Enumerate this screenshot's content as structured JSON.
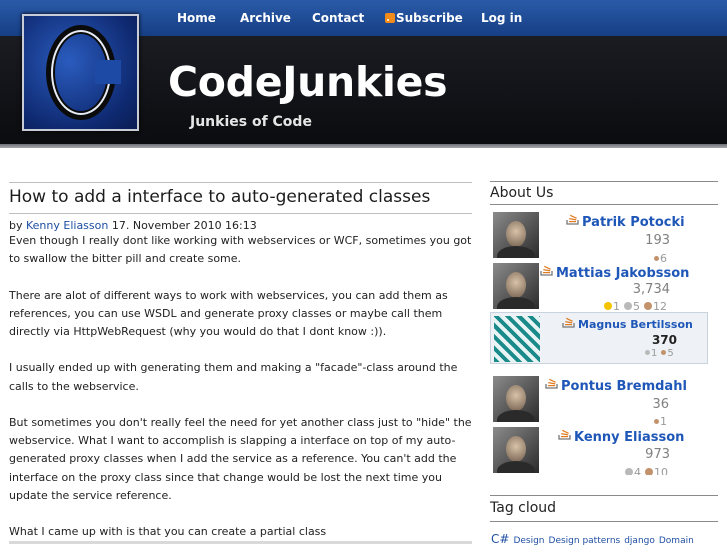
{
  "nav": {
    "items": [
      {
        "label": "Home"
      },
      {
        "label": "Archive"
      },
      {
        "label": "Contact"
      },
      {
        "label": "Subscribe",
        "icon": "rss-icon"
      },
      {
        "label": "Log in"
      }
    ]
  },
  "site": {
    "title": "CodeJunkies",
    "tagline": "Junkies of Code",
    "logo_letter": "C"
  },
  "post": {
    "title": "How to add a interface to auto-generated classes",
    "meta_prefix": "by",
    "author": "Kenny Eliasson",
    "date": "17. November 2010 16:13",
    "paragraphs": [
      "Even though I really dont like working with webservices or WCF, sometimes you got to swallow the bitter pill and create some.",
      "There are alot of different ways to work with webservices, you can add them as references, you can use WSDL and generate proxy classes or maybe call them directly via HttpWebRequest (why you would do that I dont know :)).",
      "I usually ended up with generating them and making a \"facade\"-class around the calls to the webservice.",
      "But sometimes you don't really feel the need for yet another class just to \"hide\" the webservice. What I want to accomplish is slapping a interface on top of my auto-generated proxy classes when I add the service as a reference. You can't add the interface on the proxy class since that change would be lost the next time you update the service reference.",
      "What I came up with is that you can create a partial class"
    ]
  },
  "sidebar": {
    "about_heading": "About Us",
    "users": [
      {
        "name": "Patrik Potocki",
        "rep": "193",
        "badges": [
          {
            "type": "bronze",
            "count": "6"
          }
        ]
      },
      {
        "name": "Mattias Jakobsson",
        "rep": "3,734",
        "badges": [
          {
            "type": "gold",
            "count": "1"
          },
          {
            "type": "silver",
            "count": "5"
          },
          {
            "type": "bronze",
            "count": "12"
          }
        ]
      },
      {
        "name": "Magnus Bertilsson",
        "rep": "370",
        "badges": [
          {
            "type": "silver",
            "count": "1"
          },
          {
            "type": "bronze",
            "count": "5"
          }
        ]
      },
      {
        "name": "Pontus Bremdahl",
        "rep": "36",
        "badges": [
          {
            "type": "bronze",
            "count": "1"
          }
        ]
      },
      {
        "name": "Kenny Eliasson",
        "rep": "973",
        "badges": [
          {
            "type": "silver",
            "count": "4"
          },
          {
            "type": "bronze",
            "count": "10"
          }
        ]
      }
    ],
    "tag_heading": "Tag cloud",
    "tags": [
      "C#",
      "Design",
      "Design patterns",
      "django",
      "Domain"
    ]
  },
  "colors": {
    "nav_blue": "#1f4fa3",
    "link_blue": "#1f57b8",
    "header_dark": "#121418",
    "badge_gold": "#f4c400",
    "badge_silver": "#b9b9b9",
    "badge_bronze": "#c1926b"
  }
}
